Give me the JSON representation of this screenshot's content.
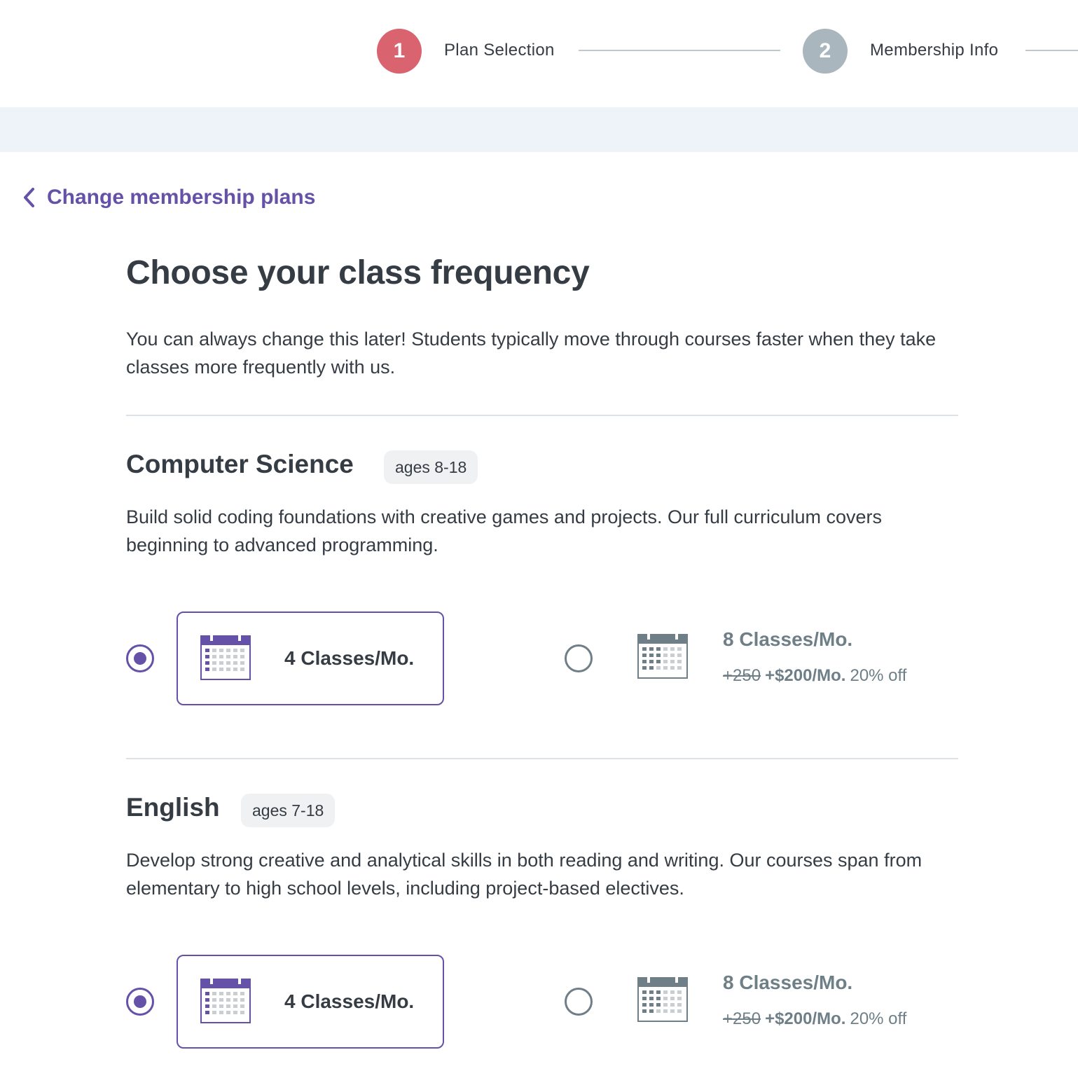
{
  "stepper": {
    "steps": [
      {
        "number": "1",
        "label": "Plan Selection",
        "state": "active"
      },
      {
        "number": "2",
        "label": "Membership Info",
        "state": "inactive"
      }
    ]
  },
  "back_link": {
    "label": "Change membership plans"
  },
  "page": {
    "title": "Choose your class frequency",
    "intro": "You can always change this later! Students typically move through courses faster when they take classes more frequently with us."
  },
  "subjects": [
    {
      "title": "Computer Science",
      "ages": "ages 8-18",
      "description": "Build solid coding foundations with creative games and projects. Our full curriculum covers beginning to advanced programming.",
      "options": [
        {
          "label": "4 Classes/Mo.",
          "selected": true,
          "icon": "calendar-icon"
        },
        {
          "label": "8 Classes/Mo.",
          "selected": false,
          "icon": "calendar-icon",
          "old_price": "+250",
          "new_price": "+$200/Mo.",
          "discount": "20% off"
        }
      ]
    },
    {
      "title": "English",
      "ages": "ages 7-18",
      "description": "Develop strong creative and analytical skills in both reading and writing. Our courses span from elementary to high school levels, including project-based electives.",
      "options": [
        {
          "label": "4 Classes/Mo.",
          "selected": true,
          "icon": "calendar-icon"
        },
        {
          "label": "8 Classes/Mo.",
          "selected": false,
          "icon": "calendar-icon",
          "old_price": "+250",
          "new_price": "+$200/Mo.",
          "discount": "20% off"
        }
      ]
    }
  ],
  "colors": {
    "accent": "#6551a8",
    "step_active": "#d9636f",
    "step_inactive": "#a9b6bd",
    "muted_text": "#6e7f88",
    "band": "#eef2f9"
  }
}
